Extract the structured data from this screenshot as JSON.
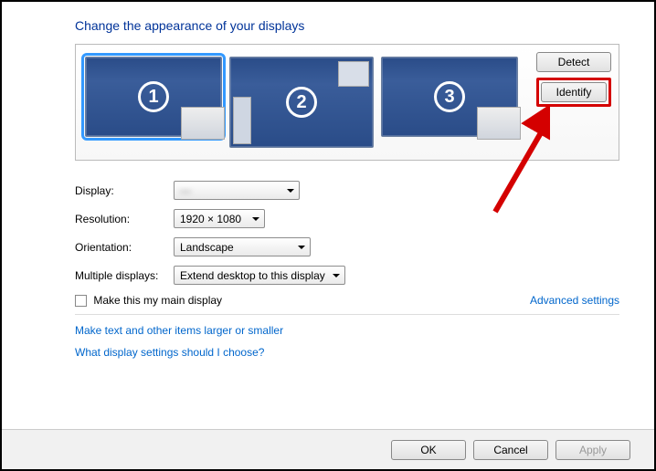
{
  "title": "Change the appearance of your displays",
  "monitors": {
    "m1": "1",
    "m2": "2",
    "m3": "3"
  },
  "buttons": {
    "detect": "Detect",
    "identify": "Identify",
    "ok": "OK",
    "cancel": "Cancel",
    "apply": "Apply"
  },
  "labels": {
    "display": "Display:",
    "resolution": "Resolution:",
    "orientation": "Orientation:",
    "multiple": "Multiple displays:",
    "mainDisplay": "Make this my main display",
    "advanced": "Advanced settings",
    "larger": "Make text and other items larger or smaller",
    "whatSettings": "What display settings should I choose?"
  },
  "values": {
    "display": "—",
    "resolution": "1920 × 1080",
    "orientation": "Landscape",
    "multiple": "Extend desktop to this display"
  }
}
